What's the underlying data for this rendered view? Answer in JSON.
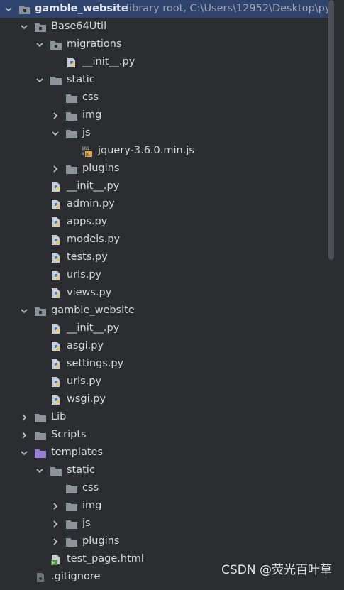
{
  "project_tree": {
    "root": {
      "label": "gamble_website",
      "hint": "library root,  C:\\Users\\12952\\Desktop\\py"
    },
    "items": [
      {
        "label": "Base64Util",
        "icon": "module-folder-icon",
        "expanded": true
      },
      {
        "label": "migrations",
        "icon": "package-folder-icon",
        "expanded": true
      },
      {
        "label": "__init__.py",
        "icon": "python-file-icon"
      },
      {
        "label": "static",
        "icon": "folder-icon",
        "expanded": true
      },
      {
        "label": "css",
        "icon": "folder-icon"
      },
      {
        "label": "img",
        "icon": "folder-icon",
        "expanded": false
      },
      {
        "label": "js",
        "icon": "folder-icon",
        "expanded": true
      },
      {
        "label": "jquery-3.6.0.min.js",
        "icon": "minified-js-file-icon"
      },
      {
        "label": "plugins",
        "icon": "folder-icon",
        "expanded": false
      },
      {
        "label": "__init__.py",
        "icon": "python-file-icon"
      },
      {
        "label": "admin.py",
        "icon": "python-file-icon"
      },
      {
        "label": "apps.py",
        "icon": "python-file-icon"
      },
      {
        "label": "models.py",
        "icon": "python-file-icon"
      },
      {
        "label": "tests.py",
        "icon": "python-file-icon"
      },
      {
        "label": "urls.py",
        "icon": "python-file-icon"
      },
      {
        "label": "views.py",
        "icon": "python-file-icon"
      },
      {
        "label": "gamble_website",
        "icon": "module-folder-icon",
        "expanded": true
      },
      {
        "label": "__init__.py",
        "icon": "python-file-icon"
      },
      {
        "label": "asgi.py",
        "icon": "python-file-icon"
      },
      {
        "label": "settings.py",
        "icon": "python-file-icon"
      },
      {
        "label": "urls.py",
        "icon": "python-file-icon"
      },
      {
        "label": "wsgi.py",
        "icon": "python-file-icon"
      },
      {
        "label": "Lib",
        "icon": "folder-icon",
        "expanded": false
      },
      {
        "label": "Scripts",
        "icon": "folder-icon",
        "expanded": false
      },
      {
        "label": "templates",
        "icon": "templates-folder-icon",
        "expanded": true
      },
      {
        "label": "static",
        "icon": "folder-icon",
        "expanded": true
      },
      {
        "label": "css",
        "icon": "folder-icon"
      },
      {
        "label": "img",
        "icon": "folder-icon",
        "expanded": false
      },
      {
        "label": "js",
        "icon": "folder-icon",
        "expanded": false
      },
      {
        "label": "plugins",
        "icon": "folder-icon",
        "expanded": false
      },
      {
        "label": "test_page.html",
        "icon": "html-file-icon"
      },
      {
        "label": ".gitignore",
        "icon": "gitignore-file-icon"
      }
    ]
  },
  "watermark": "CSDN @荧光百叶草",
  "colors": {
    "background": "#2b2d30",
    "selection": "#2e436e",
    "text": "#d5d8dd",
    "hint": "#a0a4ab",
    "folder": "#8d939b",
    "templates_folder": "#9a7dd6"
  }
}
